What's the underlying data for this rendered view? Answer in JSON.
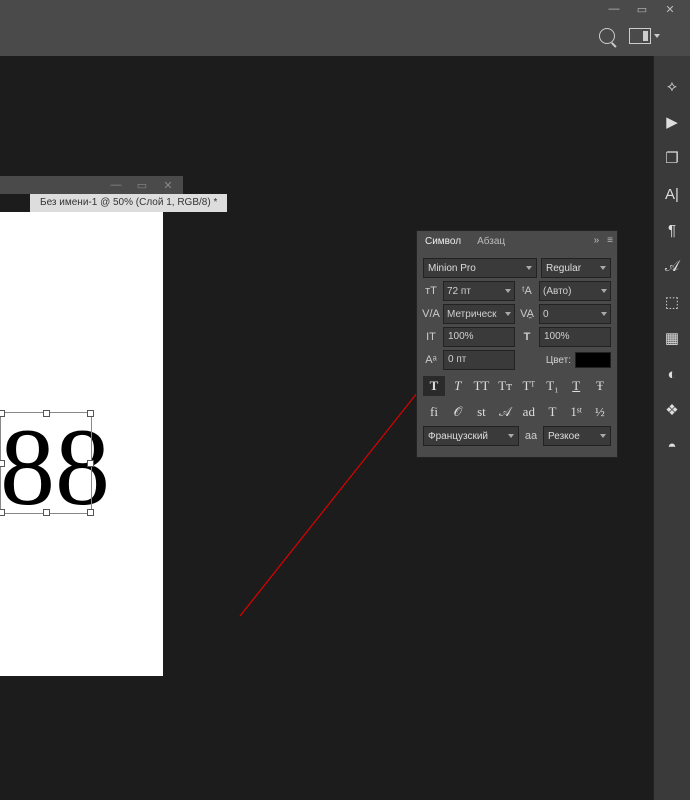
{
  "doc": {
    "tab_label": "Без имени-1 @ 50% (Слой 1, RGB/8) *",
    "text": "88"
  },
  "char_panel": {
    "tabs": {
      "symbol": "Символ",
      "paragraph": "Абзац"
    },
    "font_family": "Minion Pro",
    "font_style": "Regular",
    "font_size": "72 пт",
    "leading": "(Авто)",
    "kerning": "Метрическ",
    "tracking": "0",
    "vscale": "100%",
    "hscale": "100%",
    "baseline": "0 пт",
    "color_label": "Цвет:",
    "language": "Французский",
    "aa_label": "aа",
    "aa_value": "Резкое",
    "btns": {
      "faux_bold": "T",
      "faux_italic": "T",
      "allcaps": "TT",
      "smallcaps": "Tᴛ",
      "superscript": "Tᵀ",
      "subscript": "T₁",
      "underline": "T",
      "strike": "Ŧ"
    },
    "ot": {
      "liga": "fi",
      "swash": "𝒪",
      "oldstyle": "st",
      "titling": "𝒜",
      "ordinals": "ad",
      "jalt": "T",
      "fractions": "1ˢᵗ",
      "half": "½"
    }
  }
}
